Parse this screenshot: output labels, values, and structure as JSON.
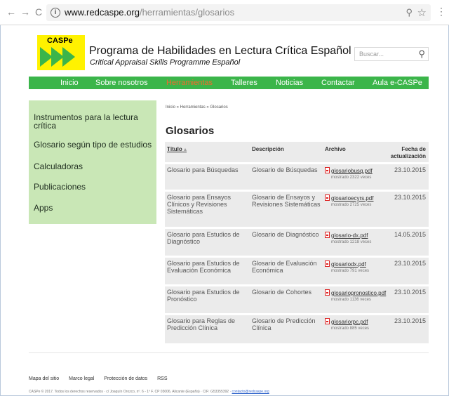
{
  "browser": {
    "url_host": "www.redcaspe.org",
    "url_path": "/herramientas/glosarios"
  },
  "header": {
    "logo_text": "CASPe",
    "title": "Programa de Habilidades en Lectura Crítica Español",
    "subtitle": "Critical Appraisal Skills Programme Español",
    "search_placeholder": "Buscar...",
    "brand_color": "#3bb54a",
    "logo_color": "#fff200"
  },
  "nav": {
    "items": [
      "Inicio",
      "Sobre nosotros",
      "Herramientas",
      "Talleres",
      "Noticias",
      "Contactar",
      "Aula e-CASPe"
    ],
    "active": "Herramientas"
  },
  "sidebar": {
    "items": [
      "Instrumentos para la lectura crítica",
      "Glosario según tipo de estudios",
      "Calculadoras",
      "Publicaciones",
      "Apps"
    ]
  },
  "main": {
    "breadcrumb": "Inicio » Herramientas » Glosarios",
    "title": "Glosarios",
    "columns": {
      "titulo": "Título",
      "descripcion": "Descripción",
      "archivo": "Archivo",
      "fecha": "Fecha de actualización"
    },
    "rows": [
      {
        "title": "Glosario para Búsquedas",
        "desc": "Glosario de Búsquedas",
        "file": "glosariobusq.pdf",
        "count": "mostrado 2322 veces",
        "date": "23.10.2015"
      },
      {
        "title": "Glosario para Ensayos Clínicos y Revisiones Sistemáticas",
        "desc": "Glosario de Ensayos y Revisiones Sistemáticas",
        "file": "glosarioecyrs.pdf",
        "count": "mostrado 2725 veces",
        "date": "23.10.2015"
      },
      {
        "title": "Glosario para Estudios de Diagnóstico",
        "desc": "Glosario de Diagnóstico",
        "file": "glosario-dx.pdf",
        "count": "mostrado 1218 veces",
        "date": "14.05.2015"
      },
      {
        "title": "Glosario para Estudios de Evaluación Económica",
        "desc": "Glosario de Evaluación Económica",
        "file": "glosariodx.pdf",
        "count": "mostrado 791 veces",
        "date": "23.10.2015"
      },
      {
        "title": "Glosario para Estudios de Pronóstico",
        "desc": "Glosario de Cohortes",
        "file": "glosariopronostico.pdf",
        "count": "mostrado 1136 veces",
        "date": "23.10.2015"
      },
      {
        "title": "Glosario para Reglas de Predicción Clínica",
        "desc": "Glosario de Predicción Clínica",
        "file": "glosariorpc.pdf",
        "count": "mostrado 885 veces",
        "date": "23.10.2015"
      }
    ]
  },
  "footer": {
    "links": [
      "Mapa del sitio",
      "Marco legal",
      "Protección de datos",
      "RSS"
    ],
    "copyright": "CASPe © 2017. Todos los derechos reservados · c/ Joaquín Orozco, nº. 6 - 1º F. CP 03006, Alicante (España) · CIF: G53355392 · ",
    "email": "contacto@redcaspe.org"
  }
}
